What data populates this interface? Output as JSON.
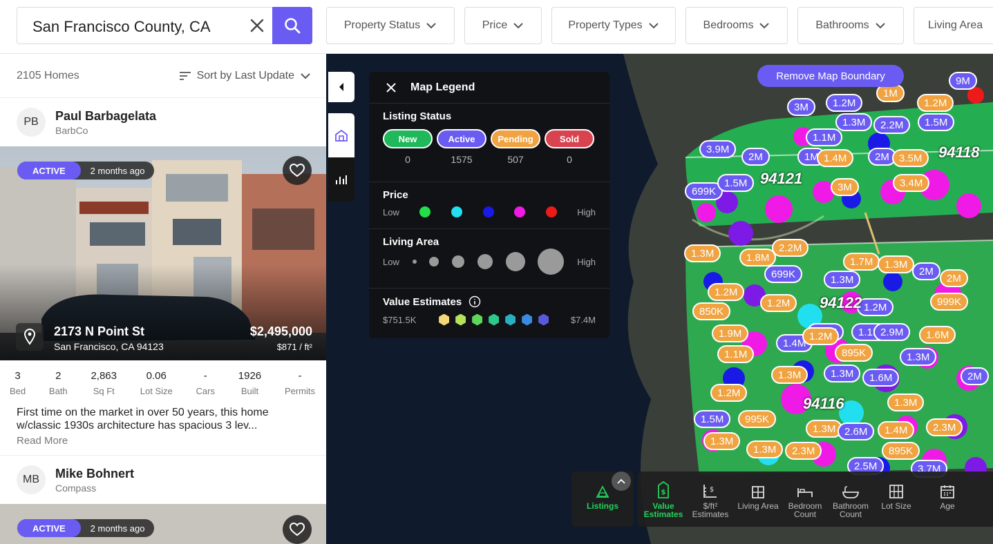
{
  "search": {
    "value": "San Francisco County, CA"
  },
  "filters": [
    "Property Status",
    "Price",
    "Property Types",
    "Bedrooms",
    "Bathrooms",
    "Living Area"
  ],
  "list": {
    "count": "2105 Homes",
    "sort_label": "Sort by Last Update",
    "listings": [
      {
        "agent_initials": "PB",
        "agent_name": "Paul Barbagelata",
        "agent_firm": "BarbCo",
        "status": "ACTIVE",
        "age": "2 months ago",
        "street": "2173 N Point St",
        "city": "San Francisco, CA 94123",
        "price": "$2,495,000",
        "price_per_sqft": "$871 / ft²",
        "stats": [
          {
            "value": "3",
            "label": "Bed"
          },
          {
            "value": "2",
            "label": "Bath"
          },
          {
            "value": "2,863",
            "label": "Sq Ft"
          },
          {
            "value": "0.06",
            "label": "Lot Size"
          },
          {
            "value": "-",
            "label": "Cars"
          },
          {
            "value": "1926",
            "label": "Built"
          },
          {
            "value": "-",
            "label": "Permits"
          }
        ],
        "description": "First time on the market in over 50 years, this home w/classic 1930s architecture has spacious 3 lev...",
        "read_more": "Read More"
      },
      {
        "agent_initials": "MB",
        "agent_name": "Mike Bohnert",
        "agent_firm": "Compass",
        "status": "ACTIVE",
        "age": "2 months ago"
      }
    ]
  },
  "map": {
    "remove_boundary": "Remove Map Boundary",
    "legend": {
      "title": "Map Legend",
      "listing_status_title": "Listing Status",
      "statuses": [
        {
          "label": "New",
          "count": "0",
          "color": "#1fb85a"
        },
        {
          "label": "Active",
          "count": "1575",
          "color": "#6a5cf2"
        },
        {
          "label": "Pending",
          "count": "507",
          "color": "#f0a340"
        },
        {
          "label": "Sold",
          "count": "0",
          "color": "#d9434f"
        }
      ],
      "price_title": "Price",
      "price_low": "Low",
      "price_high": "High",
      "price_colors": [
        "#22e04a",
        "#22dff0",
        "#1a1ae6",
        "#f01ae6",
        "#ee1a1a"
      ],
      "living_title": "Living Area",
      "living_low": "Low",
      "living_high": "High",
      "value_title": "Value Estimates",
      "value_min": "$751.5K",
      "value_max": "$7.4M",
      "value_colors": [
        "#f5d77a",
        "#b6e25a",
        "#5ed65a",
        "#2ec98a",
        "#2aaec2",
        "#3a8ae0",
        "#5a5ad8"
      ]
    },
    "zips": [
      "94121",
      "94118",
      "94122",
      "94116"
    ],
    "markers": [
      "9M",
      "1M",
      "3M",
      "1.2M",
      "1.2M",
      "1.3M",
      "2.2M",
      "1.5M",
      "1.1M",
      "3.9M",
      "2M",
      "1M",
      "1.4M",
      "2M",
      "3.5M",
      "699K",
      "1.5M",
      "3M",
      "3.4M",
      "2.2M",
      "1.3M",
      "1.8M",
      "1.7M",
      "1.3M",
      "2M",
      "699K",
      "1.3M",
      "2M",
      "1.2M",
      "1.2M",
      "1.2M",
      "999K",
      "850K",
      "1.2M",
      "1.1M",
      "2.9M",
      "1.6M",
      "1.9M",
      "1.4M",
      "1.2M",
      "1.1M",
      "895K",
      "1.3M",
      "1.3M",
      "1.3M",
      "1.6M",
      "2M",
      "1.2M",
      "1.3M",
      "1.5M",
      "995K",
      "1.3M",
      "2.6M",
      "1.4M",
      "2.3M",
      "1.3M",
      "1.3M",
      "2.3M",
      "895K",
      "2.5M",
      "3.7M"
    ],
    "toolbar": [
      {
        "label": "Listings",
        "active": true
      },
      {
        "label": "Value Estimates",
        "active": true
      },
      {
        "label": "$/ft² Estimates",
        "active": false
      },
      {
        "label": "Living Area",
        "active": false
      },
      {
        "label": "Bedroom Count",
        "active": false
      },
      {
        "label": "Bathroom Count",
        "active": false
      },
      {
        "label": "Lot Size",
        "active": false
      },
      {
        "label": "Age",
        "active": false
      }
    ]
  }
}
